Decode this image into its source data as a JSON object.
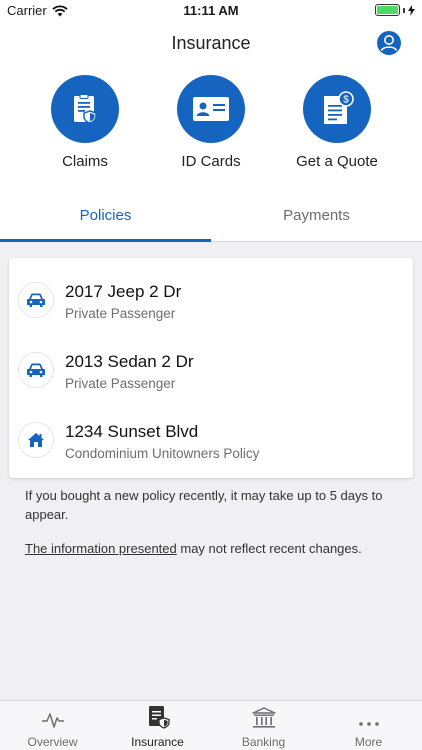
{
  "status": {
    "carrier": "Carrier",
    "time": "11:11 AM"
  },
  "header": {
    "title": "Insurance"
  },
  "actions": [
    {
      "label": "Claims",
      "icon": "claims-icon"
    },
    {
      "label": "ID Cards",
      "icon": "id-card-icon"
    },
    {
      "label": "Get a Quote",
      "icon": "quote-icon"
    }
  ],
  "tabs": [
    {
      "label": "Policies",
      "active": true
    },
    {
      "label": "Payments",
      "active": false
    }
  ],
  "policies": [
    {
      "title": "2017 Jeep 2 Dr",
      "subtitle": "Private Passenger",
      "icon": "car-icon"
    },
    {
      "title": "2013 Sedan 2 Dr",
      "subtitle": "Private Passenger",
      "icon": "car-icon"
    },
    {
      "title": "1234 Sunset Blvd",
      "subtitle": "Condominium Unitowners Policy",
      "icon": "home-icon"
    }
  ],
  "notes": {
    "recent": "If you bought a new policy recently, it may take up to 5 days to appear.",
    "link": "The information presented",
    "rest": " may not reflect recent changes."
  },
  "tabbar": [
    {
      "label": "Overview",
      "icon": "activity-icon"
    },
    {
      "label": "Insurance",
      "icon": "insurance-icon",
      "active": true
    },
    {
      "label": "Banking",
      "icon": "bank-icon"
    },
    {
      "label": "More",
      "icon": "more-icon"
    }
  ],
  "colors": {
    "accent": "#1565c0",
    "background": "#efeff4",
    "battery": "#4cd964"
  }
}
